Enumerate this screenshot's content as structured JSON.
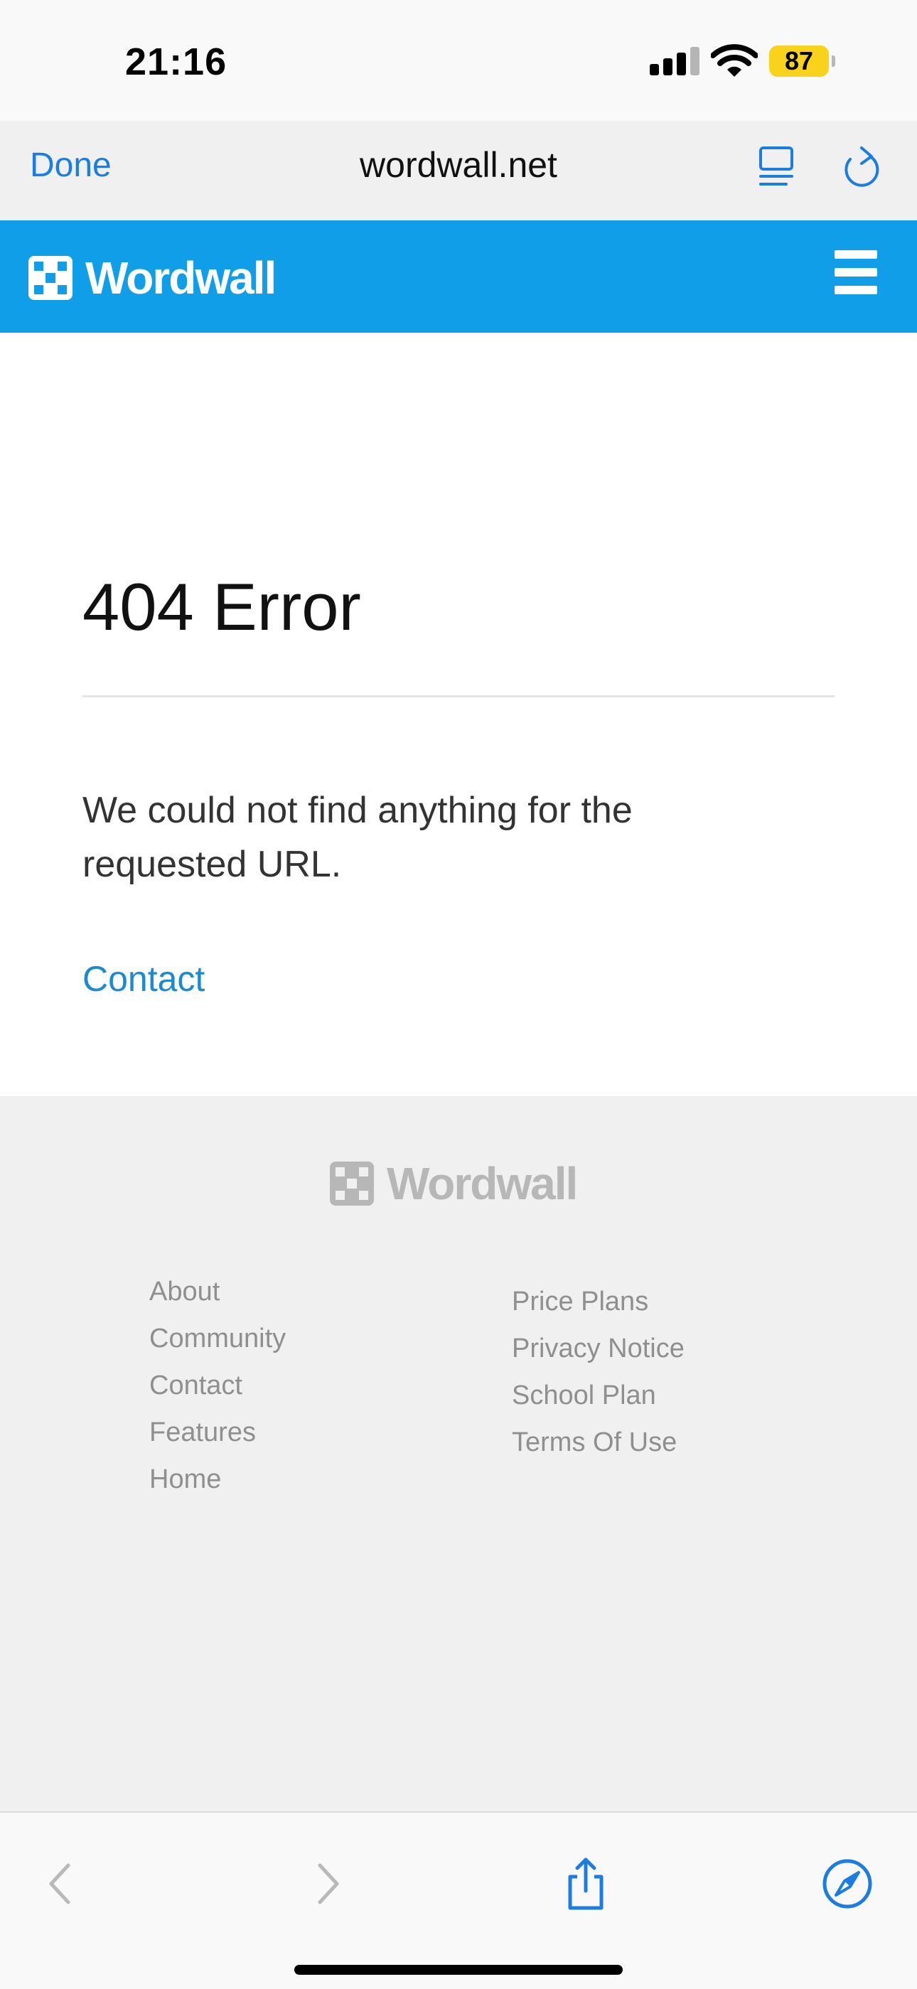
{
  "status_bar": {
    "time": "21:16",
    "battery": "87",
    "battery_color": "#f9d21b"
  },
  "browser": {
    "done_label": "Done",
    "domain": "wordwall.net",
    "accent_color": "#1b7ce2",
    "icons": [
      "reader-mode-icon",
      "reload-icon",
      "back-icon",
      "forward-icon",
      "share-icon",
      "compass-icon"
    ]
  },
  "site_header": {
    "brand": "Wordwall",
    "background_color": "#109ee9",
    "menu_icon": "hamburger-menu-icon"
  },
  "main": {
    "title": "404 Error",
    "message": "We could not find anything for the requested URL.",
    "contact_link": "Contact"
  },
  "footer": {
    "brand": "Wordwall",
    "left_links": [
      "About",
      "Community",
      "Contact",
      "Features",
      "Home"
    ],
    "right_links": [
      "Price Plans",
      "Privacy Notice",
      "School Plan",
      "Terms Of Use"
    ]
  }
}
